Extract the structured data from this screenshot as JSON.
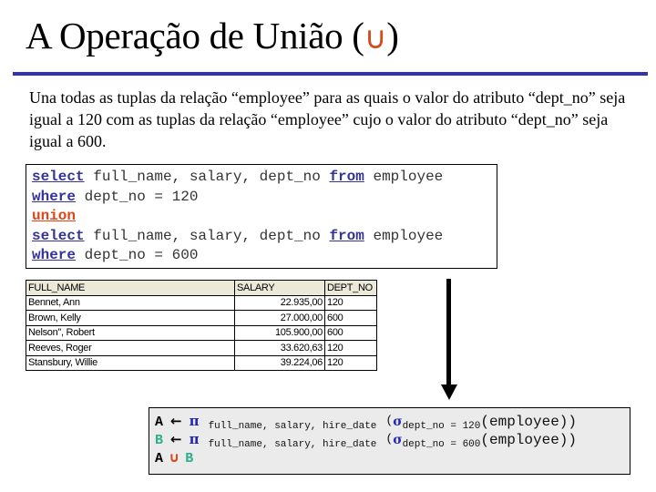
{
  "title": {
    "text": "A Operação de União (",
    "symbol": "∪",
    "close": ")",
    "symbol_color": "#d24a1e"
  },
  "description": "Una todas as tuplas da relação “employee” para as quais o valor do atributo “dept_no” seja igual a 120 com as tuplas da relação “employee” cujo o valor do atributo “dept_no” seja igual a 600.",
  "sql": {
    "keywords_color": "#333399",
    "union_color": "#e04515",
    "lines": [
      {
        "kw1": "select",
        "t1": " full_name, salary, dept_no ",
        "kw2": "from",
        "t2": " employee"
      },
      {
        "kw1": "where",
        "t1": " dept_no = 120"
      },
      {
        "kw_union": "union"
      },
      {
        "kw1": "select",
        "t1": " full_name, salary, dept_no ",
        "kw2": "from",
        "t2": " employee"
      },
      {
        "kw1": "where",
        "t1": " dept_no = 600"
      }
    ]
  },
  "result_table": {
    "columns": [
      "FULL_NAME",
      "SALARY",
      "DEPT_NO"
    ],
    "rows": [
      [
        "Bennet, Ann",
        "22.935,00",
        "120"
      ],
      [
        "Brown, Kelly",
        "27.000,00",
        "600"
      ],
      [
        "Nelson'', Robert",
        "105.900,00",
        "600"
      ],
      [
        "Reeves, Roger",
        "33.620,63",
        "120"
      ],
      [
        "Stansbury, Willie",
        "39.224,06",
        "120"
      ]
    ]
  },
  "arrow_icon": "down-arrow-icon",
  "relational_algebra": {
    "lines": [
      {
        "rel": "A",
        "assign": "←",
        "pi": "π",
        "proj": "full_name, salary, hire_date",
        "open": "(",
        "sigma": "σ",
        "cond": "dept_no = 120",
        "arg": "(employee))"
      },
      {
        "rel": "B",
        "assign": "←",
        "pi": "π",
        "proj": "full_name, salary, hire_date",
        "open": "(",
        "sigma": "σ",
        "cond": "dept_no = 600",
        "arg": "(employee))"
      }
    ],
    "union_expr": {
      "left": "A",
      "op": "∪",
      "right": "B"
    },
    "colors": {
      "A": "#000000",
      "B": "#2ab08a",
      "pi_sigma": "#2424b8",
      "union": "#d24a1e"
    }
  }
}
